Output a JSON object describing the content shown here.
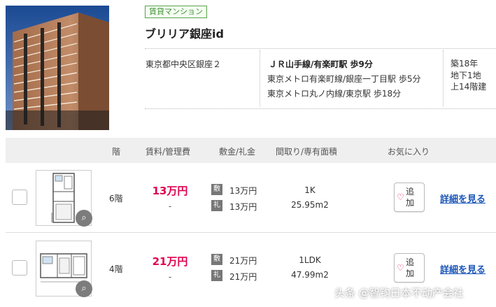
{
  "listing": {
    "badge": "賃貸マンション",
    "name": "ブリリア銀座id",
    "address": "東京都中央区銀座２",
    "stations": [
      "ＪＲ山手線/有楽町駅 歩9分",
      "東京メトロ有楽町線/銀座一丁目駅 歩5分",
      "東京メトロ丸ノ内線/東京駅 歩18分"
    ],
    "age": "築18年",
    "basement": "地下1地",
    "floors": "上14階建"
  },
  "table": {
    "headers": [
      "階",
      "賃料/管理費",
      "敷金/礼金",
      "間取り/専有面積",
      "お気に入り"
    ],
    "rows": [
      {
        "floor": "6階",
        "rent": "13万円",
        "mgmt": "-",
        "shiki_tag": "敷",
        "deposit": "13万円",
        "rei_tag": "礼",
        "key_money": "13万円",
        "layout": "1K",
        "area": "25.95m2",
        "fav_label": "追加",
        "detail": "詳細を見る"
      },
      {
        "floor": "4階",
        "rent": "21万円",
        "mgmt": "-",
        "shiki_tag": "敷",
        "deposit": "21万円",
        "rei_tag": "礼",
        "key_money": "21万円",
        "layout": "1LDK",
        "area": "47.99m2",
        "fav_label": "追加",
        "detail": "詳細を見る"
      }
    ]
  },
  "watermark": "头条 @智钧日本不动产会社",
  "colors": {
    "accent_rent": "#e0004d",
    "link": "#1a55b8",
    "badge_green": "#3f8d33"
  }
}
